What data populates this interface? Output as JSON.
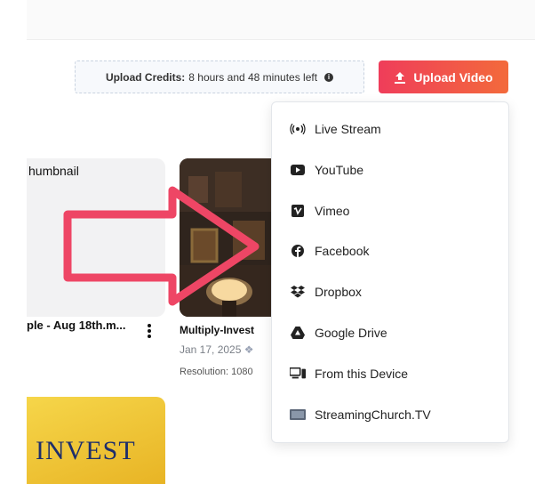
{
  "header": {
    "credits_label": "Upload Credits:",
    "credits_value": "8 hours and 48 minutes left",
    "upload_button": "Upload Video"
  },
  "videos": [
    {
      "thumb_label": "humbnail",
      "title": "ple - Aug 18th.m..."
    },
    {
      "title": "Multiply-Invest",
      "date": "Jan 17, 2025",
      "resolution": "Resolution:  1080"
    },
    {
      "thumb_text": "INVEST"
    }
  ],
  "upload_menu": {
    "items": [
      {
        "label": "Live Stream",
        "icon": "live-stream-icon"
      },
      {
        "label": "YouTube",
        "icon": "youtube-icon"
      },
      {
        "label": "Vimeo",
        "icon": "vimeo-icon"
      },
      {
        "label": "Facebook",
        "icon": "facebook-icon"
      },
      {
        "label": "Dropbox",
        "icon": "dropbox-icon"
      },
      {
        "label": "Google Drive",
        "icon": "google-drive-icon"
      },
      {
        "label": "From this Device",
        "icon": "device-icon"
      },
      {
        "label": "StreamingChurch.TV",
        "icon": "streamingchurch-icon"
      }
    ]
  },
  "colors": {
    "accent_start": "#ef3d5a",
    "accent_end": "#f36a3b",
    "arrow": "#ee4665"
  }
}
